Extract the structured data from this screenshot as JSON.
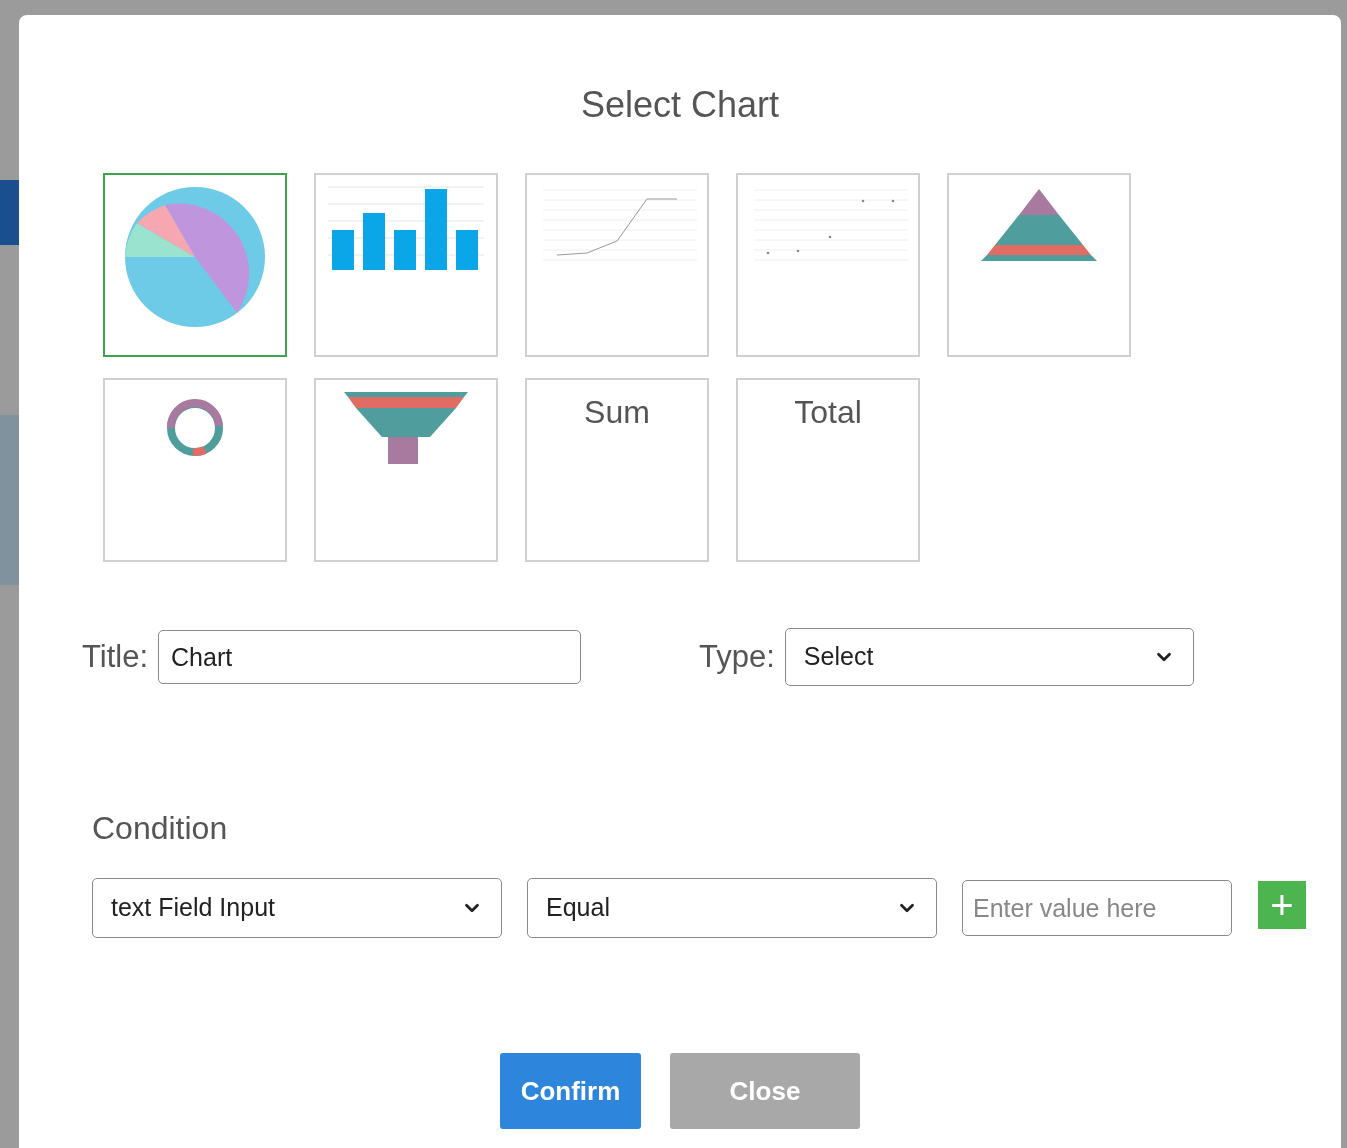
{
  "dialog": {
    "title": "Select Chart"
  },
  "chart_tiles": [
    {
      "kind": "pie",
      "selected": true
    },
    {
      "kind": "bar",
      "selected": false
    },
    {
      "kind": "line",
      "selected": false
    },
    {
      "kind": "scatter",
      "selected": false
    },
    {
      "kind": "pyramid",
      "selected": false
    },
    {
      "kind": "donut",
      "selected": false
    },
    {
      "kind": "funnel",
      "selected": false
    },
    {
      "kind": "text",
      "label": "Sum",
      "selected": false
    },
    {
      "kind": "text",
      "label": "Total",
      "selected": false
    }
  ],
  "title_field": {
    "label": "Title:",
    "value": "Chart"
  },
  "type_field": {
    "label": "Type:",
    "value": "Select"
  },
  "condition": {
    "heading": "Condition",
    "field": "text Field Input",
    "operator": "Equal",
    "value_placeholder": "Enter value here",
    "add_button": "+"
  },
  "buttons": [
    {
      "label": "Confirm",
      "kind": "primary"
    },
    {
      "label": "Close",
      "kind": "secondary"
    }
  ]
}
